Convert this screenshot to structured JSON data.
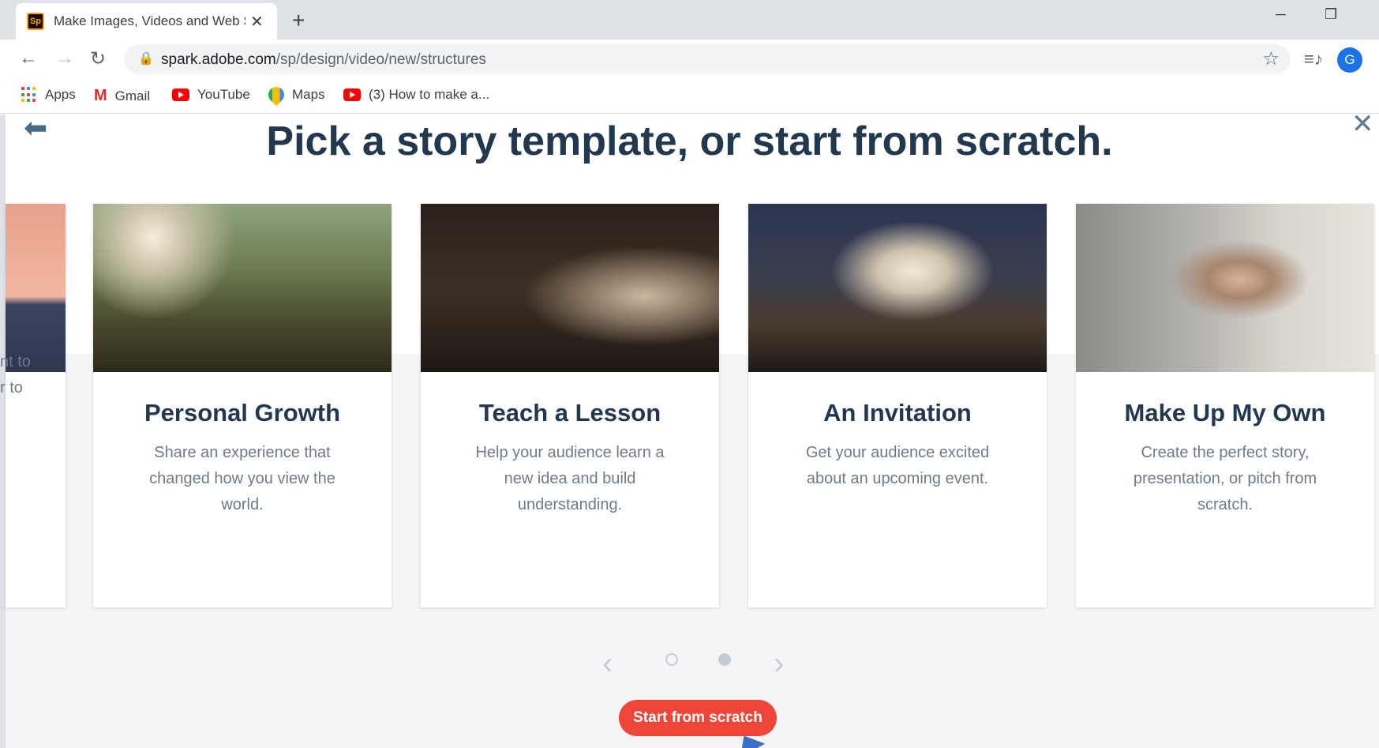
{
  "browser": {
    "tab_title": "Make Images, Videos and Web Stories",
    "tab_favicon_text": "Sp",
    "new_tab_symbol": "+",
    "url_host": "spark.adobe.com",
    "url_path": "/sp/design/video/new/structures",
    "avatar_letter": "G",
    "bookmarks": [
      {
        "label": "Apps",
        "icon": "apps-grid-icon"
      },
      {
        "label": "Gmail",
        "icon": "gmail-icon"
      },
      {
        "label": "YouTube",
        "icon": "youtube-icon"
      },
      {
        "label": "Maps",
        "icon": "maps-icon"
      },
      {
        "label": "(3) How to make a...",
        "icon": "youtube-icon"
      }
    ]
  },
  "page": {
    "headline": "Pick a story template, or start from scratch.",
    "partial_card": {
      "line1": "nt to",
      "line2": "r to"
    },
    "cards": [
      {
        "title": "Personal Growth",
        "description": "Share an experience that changed how you view the world."
      },
      {
        "title": "Teach a Lesson",
        "description": "Help your audience learn a new idea and build understanding."
      },
      {
        "title": "An Invitation",
        "description": "Get your audience excited about an upcoming event."
      },
      {
        "title": "Make Up My Own",
        "description": "Create the perfect story, presentation, or pitch from scratch."
      }
    ],
    "pager": {
      "prev": "‹",
      "next": "›"
    },
    "start_button": "Start from scratch"
  },
  "colors": {
    "heading": "#22384f",
    "body_text": "#6e7b88",
    "accent_button": "#f0463a"
  }
}
